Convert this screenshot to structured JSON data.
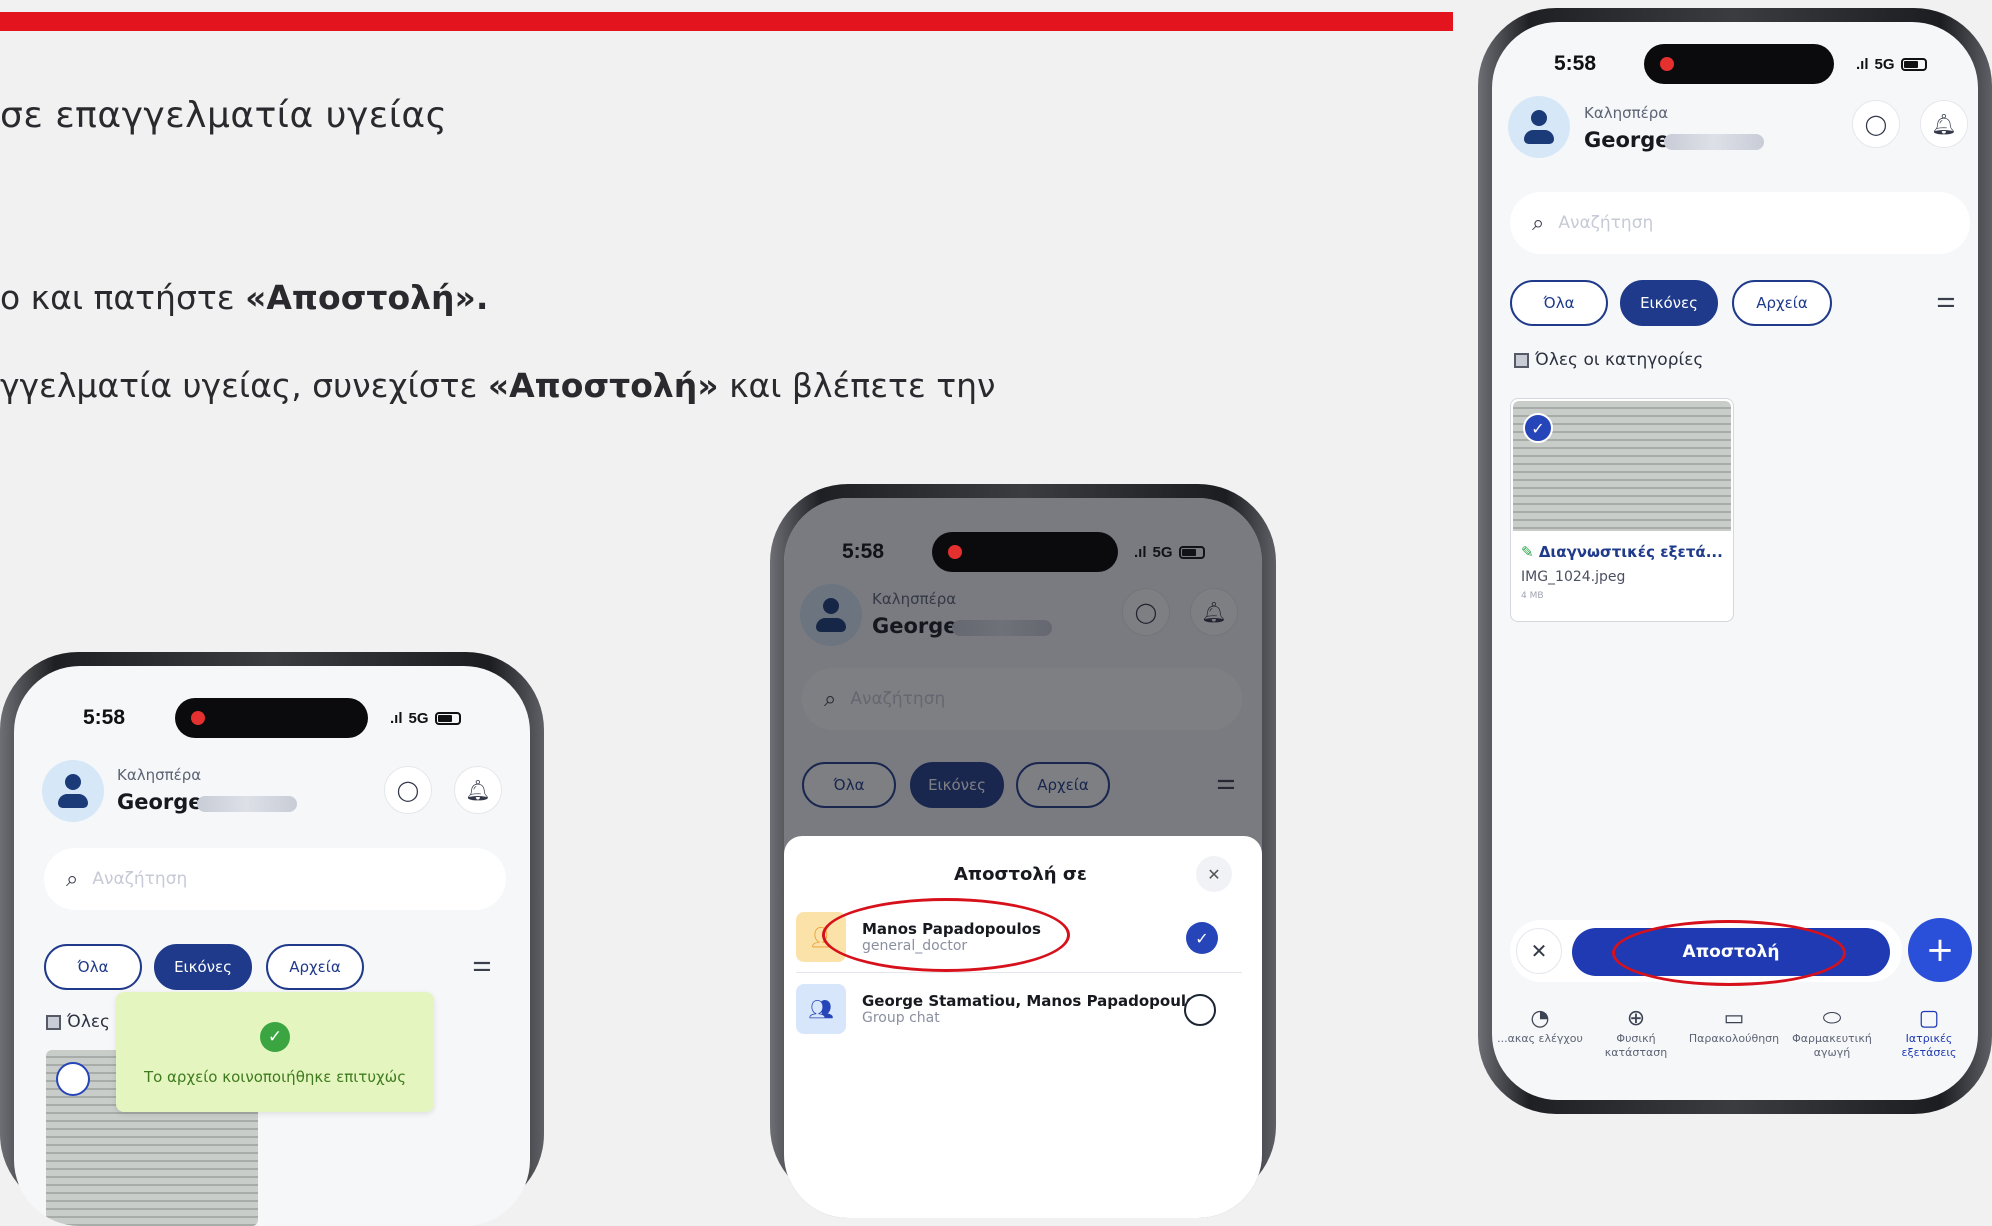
{
  "slide": {
    "line1": "σε επαγγελματία υγείας",
    "line2_prefix": "ο και πατήστε ",
    "line2_bold": "«Αποστολή».",
    "line3_prefix": "γγελματία υγείας, συνεχίστε ",
    "line3_bold": "«Αποστολή»",
    "line3_suffix": " και βλέπετε την"
  },
  "status": {
    "time": "5:58",
    "network": "5G"
  },
  "header": {
    "greeting": "Καλησπέρα",
    "name": "George"
  },
  "search": {
    "placeholder": "Αναζήτηση"
  },
  "chips": {
    "all": "Όλα",
    "images": "Εικόνες",
    "files": "Αρχεία"
  },
  "categories": {
    "all": "Όλες οι κατηγορίες",
    "all_short": "Όλες"
  },
  "file": {
    "title": "Διαγνωστικές εξετά...",
    "name": "IMG_1024.jpeg",
    "size": "4 MB"
  },
  "toast": {
    "message": "Το αρχείο κοινοποιήθηκε επιτυχώς"
  },
  "modal": {
    "title": "Αποστολή σε",
    "contacts": [
      {
        "name": "Manos Papadopoulos",
        "sub": "general_doctor",
        "selected": true
      },
      {
        "name": "George Stamatiou, Manos Papadopoulos",
        "sub": "Group chat",
        "selected": false
      }
    ]
  },
  "send": {
    "label": "Αποστολή"
  },
  "nav": [
    {
      "label": "...ακας ελέγχου",
      "icon": "gauge-icon"
    },
    {
      "label": "Φυσική\nκατάσταση",
      "icon": "dumbbell-icon"
    },
    {
      "label": "Παρακολούθηση",
      "icon": "monitor-icon"
    },
    {
      "label": "Φαρμακευτική\nαγωγή",
      "icon": "pill-icon"
    },
    {
      "label": "Ιατρικές\nεξετάσεις",
      "icon": "document-icon",
      "active": true
    }
  ],
  "colors": {
    "brand_red": "#e3141d",
    "primary_blue": "#1f3a8a",
    "success_green": "#3aa541"
  }
}
